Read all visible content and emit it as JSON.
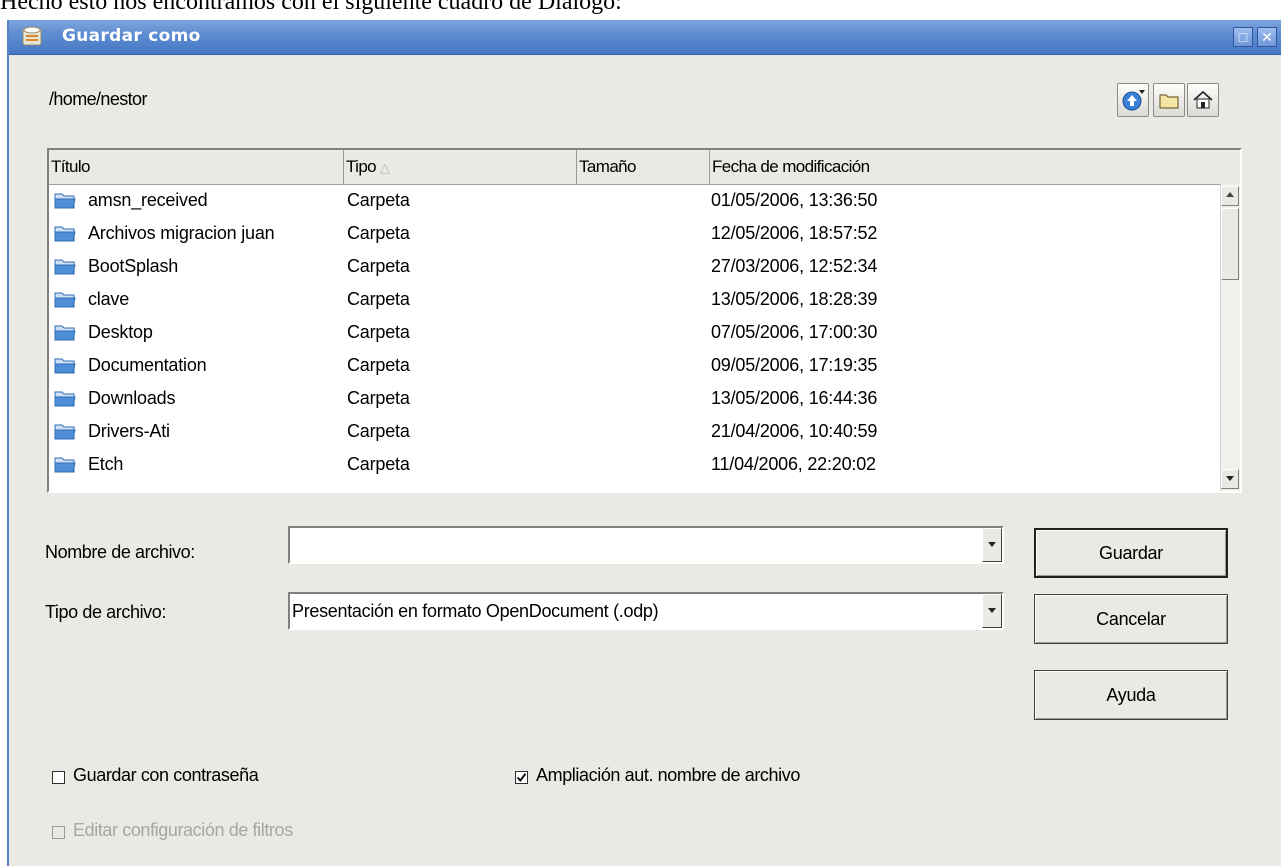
{
  "caption": "Hecho esto nos encontramos con el siguiente cuadro de Dialogo:",
  "window": {
    "title": "Guardar como",
    "buttons": {
      "maximize_glyph": "□",
      "close_glyph": "✕"
    }
  },
  "path": "/home/nestor",
  "toolbar": {
    "icons": [
      "up-one-level-icon",
      "new-folder-icon",
      "home-folder-icon"
    ]
  },
  "file_list": {
    "columns": [
      "Título",
      "Tipo",
      "Tamaño",
      "Fecha de modificación"
    ],
    "sort_indicator": "△",
    "rows": [
      {
        "name": "amsn_received",
        "type": "Carpeta",
        "size": "",
        "date": "01/05/2006, 13:36:50"
      },
      {
        "name": "Archivos migracion juan",
        "type": "Carpeta",
        "size": "",
        "date": "12/05/2006, 18:57:52"
      },
      {
        "name": "BootSplash",
        "type": "Carpeta",
        "size": "",
        "date": "27/03/2006, 12:52:34"
      },
      {
        "name": "clave",
        "type": "Carpeta",
        "size": "",
        "date": "13/05/2006, 18:28:39"
      },
      {
        "name": "Desktop",
        "type": "Carpeta",
        "size": "",
        "date": "07/05/2006, 17:00:30"
      },
      {
        "name": "Documentation",
        "type": "Carpeta",
        "size": "",
        "date": "09/05/2006, 17:19:35"
      },
      {
        "name": "Downloads",
        "type": "Carpeta",
        "size": "",
        "date": "13/05/2006, 16:44:36"
      },
      {
        "name": "Drivers-Ati",
        "type": "Carpeta",
        "size": "",
        "date": "21/04/2006, 10:40:59"
      },
      {
        "name": "Etch",
        "type": "Carpeta",
        "size": "",
        "date": "11/04/2006, 22:20:02"
      }
    ]
  },
  "form": {
    "filename_label": "Nombre de archivo:",
    "filename_value": "",
    "filetype_label": "Tipo de archivo:",
    "filetype_value": "Presentación en formato OpenDocument (.odp)"
  },
  "buttons": {
    "save": "Guardar",
    "cancel": "Cancelar",
    "help": "Ayuda"
  },
  "options": {
    "password": {
      "label": "Guardar con contraseña",
      "checked": false
    },
    "auto_extension": {
      "label": "Ampliación aut. nombre de archivo",
      "checked": true
    },
    "filter_settings": {
      "label": "Editar configuración de filtros",
      "checked": false,
      "disabled": true
    }
  },
  "colors": {
    "titlebar": "#5b8bd1",
    "dialog_bg": "#ebe9e4",
    "folder_icon": "#3f7fc8",
    "disabled_text": "#a6a6a6"
  }
}
